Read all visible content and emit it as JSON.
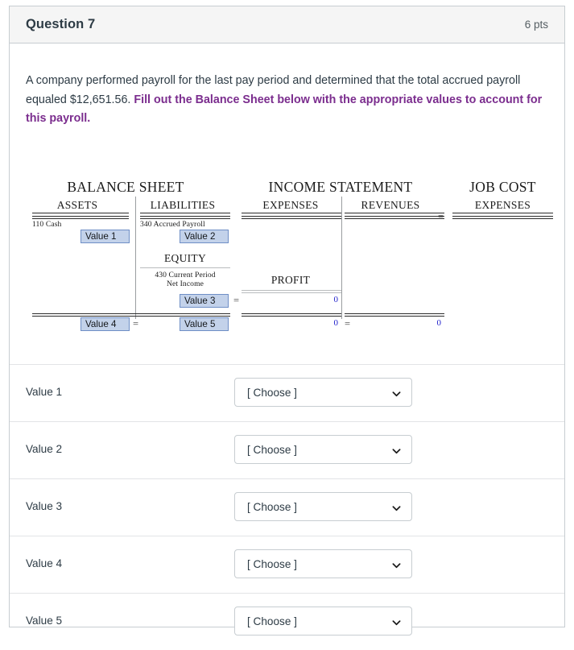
{
  "header": {
    "title": "Question 7",
    "points": "6 pts"
  },
  "prompt": {
    "part1": "A company performed payroll for the last pay period and determined that the total accrued payroll equaled $12,651.56.",
    "part2": "Fill out the Balance Sheet below with the appropriate values to account for this payroll.",
    "highlight_color": "#7b2d8e"
  },
  "diagram": {
    "balance_sheet": {
      "title": "BALANCE SHEET",
      "assets_header": "ASSETS",
      "liabilities_header": "LIABILITIES",
      "equity_header": "EQUITY",
      "asset_account": "110 Cash",
      "liability_account": "340 Accrued Payroll",
      "equity_account_line1": "430 Current Period",
      "equity_account_line2": "Net Income",
      "value1": "Value 1",
      "value2": "Value 2",
      "value3": "Value 3",
      "value4": "Value 4",
      "value5": "Value 5",
      "equals": "="
    },
    "income_statement": {
      "title": "INCOME STATEMENT",
      "expenses_header": "EXPENSES",
      "revenues_header": "REVENUES",
      "profit_label": "PROFIT",
      "profit_value": "0",
      "expenses_total": "0",
      "revenues_total": "0",
      "equals": "=",
      "value_color": "#2222cc"
    },
    "job_cost": {
      "title": "JOB COST",
      "expenses_header": "EXPENSES",
      "equals": "="
    },
    "box_fill": "#c3d2ea",
    "box_border": "#6f8fc6"
  },
  "form": {
    "rows": [
      {
        "label": "Value 1",
        "selected": "[ Choose ]"
      },
      {
        "label": "Value 2",
        "selected": "[ Choose ]"
      },
      {
        "label": "Value 3",
        "selected": "[ Choose ]"
      },
      {
        "label": "Value 4",
        "selected": "[ Choose ]"
      },
      {
        "label": "Value 5",
        "selected": "[ Choose ]"
      }
    ]
  }
}
